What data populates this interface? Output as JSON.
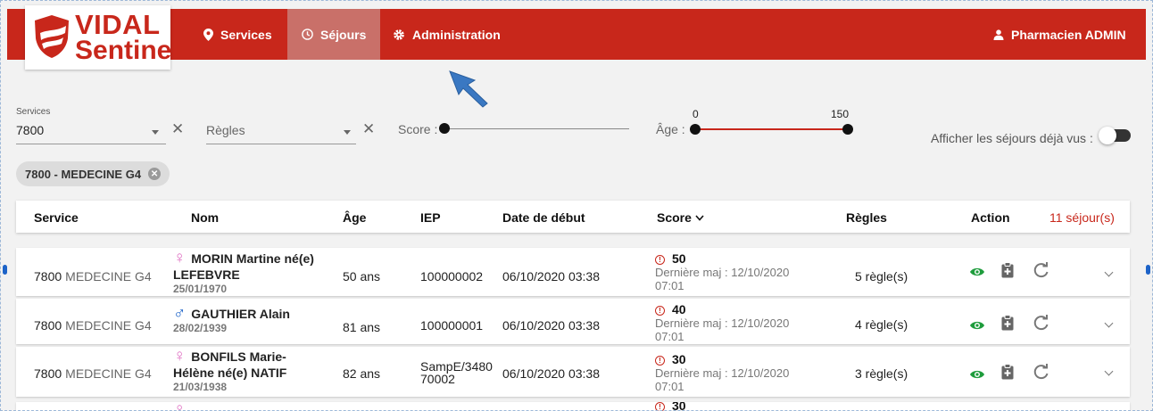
{
  "logo": {
    "line1": "VIDAL",
    "line2": "Sentinel"
  },
  "nav": {
    "services": "Services",
    "sejours": "Séjours",
    "administration": "Administration"
  },
  "user": {
    "name": "Pharmacien ADMIN"
  },
  "filters": {
    "services_label": "Services",
    "services_value": "7800",
    "regles_placeholder": "Règles",
    "score_label": "Score :",
    "age_label": "Âge :",
    "age_min": "0",
    "age_max": "150",
    "age_range_fraction": [
      0,
      1
    ],
    "score_fraction": 0,
    "show_seen_label": "Afficher les séjours déjà vus :",
    "show_seen_on": false
  },
  "chip": {
    "label": "7800 - MEDECINE G4"
  },
  "table": {
    "headers": {
      "service": "Service",
      "nom": "Nom",
      "age": "Âge",
      "iep": "IEP",
      "date": "Date de début",
      "score": "Score",
      "regles": "Règles",
      "action": "Action"
    },
    "count": "11 séjour(s)",
    "rows": [
      {
        "code": "7800",
        "service": "MEDECINE G4",
        "gender": "f",
        "name1": "MORIN Martine né(e)",
        "name2": "LEFEBVRE",
        "dob": "25/01/1970",
        "age": "50 ans",
        "iep": "100000002",
        "date": "06/10/2020 03:38",
        "score": "50",
        "maj1": "Dernière maj : 12/10/2020",
        "maj2": "07:01",
        "regles": "5 règle(s)"
      },
      {
        "code": "7800",
        "service": "MEDECINE G4",
        "gender": "m",
        "name1": "GAUTHIER Alain",
        "name2": "",
        "dob": "28/02/1939",
        "age": "81 ans",
        "iep": "100000001",
        "date": "06/10/2020 03:38",
        "score": "40",
        "maj1": "Dernière maj : 12/10/2020",
        "maj2": "07:01",
        "regles": "4 règle(s)"
      },
      {
        "code": "7800",
        "service": "MEDECINE G4",
        "gender": "f",
        "name1": "BONFILS Marie-",
        "name2": "Hélène né(e) NATIF",
        "dob": "21/03/1938",
        "age": "82 ans",
        "iep": "SampE/3480",
        "iep2": "70002",
        "date": "06/10/2020 03:38",
        "score": "30",
        "maj1": "Dernière maj : 12/10/2020",
        "maj2": "07:01",
        "regles": "3 règle(s)"
      }
    ],
    "partial_score": "30"
  },
  "colors": {
    "brand": "#c8271b",
    "eye": "#1e9c3c",
    "female": "#e073c4",
    "male": "#1d63c8"
  },
  "icons": [
    "map-pin-icon",
    "clock-icon",
    "gear-icon",
    "user-icon",
    "eye-icon",
    "clipboard-plus-icon",
    "refresh-icon",
    "chevron-down-icon",
    "sort-chevron-icon",
    "warning-circle-icon"
  ]
}
